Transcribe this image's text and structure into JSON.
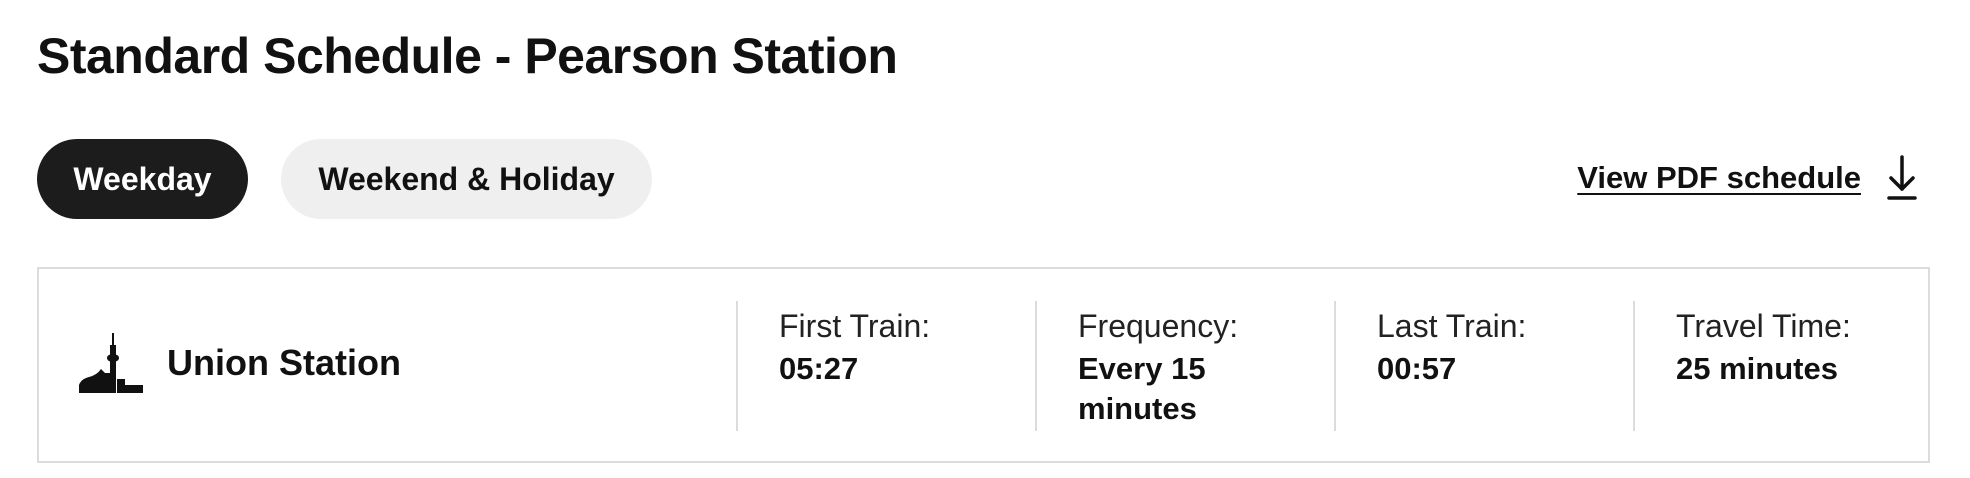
{
  "page": {
    "title": "Standard Schedule - Pearson Station"
  },
  "tabs": [
    {
      "label": "Weekday",
      "selected": true
    },
    {
      "label": "Weekend & Holiday",
      "selected": false
    }
  ],
  "pdf_link": {
    "label": "View PDF schedule",
    "icon": "download-icon"
  },
  "schedule": {
    "station": {
      "name": "Union Station",
      "icon": "cn-tower-icon"
    },
    "first_train": {
      "label": "First Train:",
      "value": "05:27"
    },
    "frequency": {
      "label": "Frequency:",
      "value_line1": "Every 15",
      "value_line2": "minutes"
    },
    "last_train": {
      "label": "Last Train:",
      "value": "00:57"
    },
    "travel_time": {
      "label": "Travel Time:",
      "value": "25 minutes"
    }
  },
  "colors": {
    "selected_tab_bg": "#1c1c1c",
    "unselected_tab_bg": "#efefef",
    "border": "#dcdcdc",
    "text": "#111111"
  }
}
